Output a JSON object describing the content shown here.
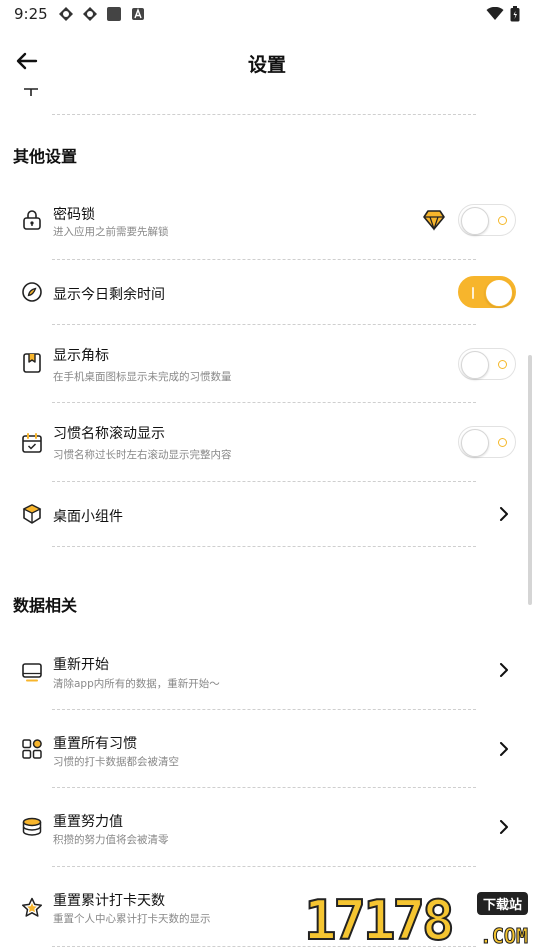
{
  "status_bar": {
    "time": "9:25",
    "icons": [
      "app-icon",
      "app-icon",
      "stop-icon",
      "a-icon"
    ],
    "right_icons": [
      "wifi-icon",
      "battery-icon"
    ]
  },
  "header": {
    "back_icon": "arrow-left-icon",
    "title": "设置"
  },
  "sections": [
    {
      "title": "其他设置",
      "items": [
        {
          "icon": "lock-icon",
          "title": "密码锁",
          "subtitle": "进入应用之前需要先解锁",
          "control": "toggle",
          "checked": false,
          "badge_icon": "vip-diamond-icon"
        },
        {
          "icon": "compass-icon",
          "title": "显示今日剩余时间",
          "subtitle": "",
          "control": "toggle",
          "checked": true
        },
        {
          "icon": "bookmark-icon",
          "title": "显示角标",
          "subtitle": "在手机桌面图标显示未完成的习惯数量",
          "control": "toggle",
          "checked": false
        },
        {
          "icon": "calendar-icon",
          "title": "习惯名称滚动显示",
          "subtitle": "习惯名称过长时左右滚动显示完整内容",
          "control": "toggle",
          "checked": false
        },
        {
          "icon": "cube-icon",
          "title": "桌面小组件",
          "subtitle": "",
          "control": "chevron"
        }
      ]
    },
    {
      "title": "数据相关",
      "items": [
        {
          "icon": "monitor-icon",
          "title": "重新开始",
          "subtitle": "清除app内所有的数据，重新开始～",
          "control": "chevron"
        },
        {
          "icon": "grid-icon",
          "title": "重置所有习惯",
          "subtitle": "习惯的打卡数据都会被清空",
          "control": "chevron"
        },
        {
          "icon": "coins-icon",
          "title": "重置努力值",
          "subtitle": "积攒的努力值将会被清零",
          "control": "chevron"
        },
        {
          "icon": "star-icon",
          "title": "重置累计打卡天数",
          "subtitle": "重置个人中心累计打卡天数的显示",
          "control": "none"
        }
      ]
    }
  ],
  "watermark": {
    "digits": "17178",
    "tag": "下载站",
    "domain": ".COM"
  },
  "colors": {
    "accent": "#f7b52c",
    "text_primary": "#111111",
    "text_secondary": "#888888",
    "divider": "#cfcfcf"
  }
}
